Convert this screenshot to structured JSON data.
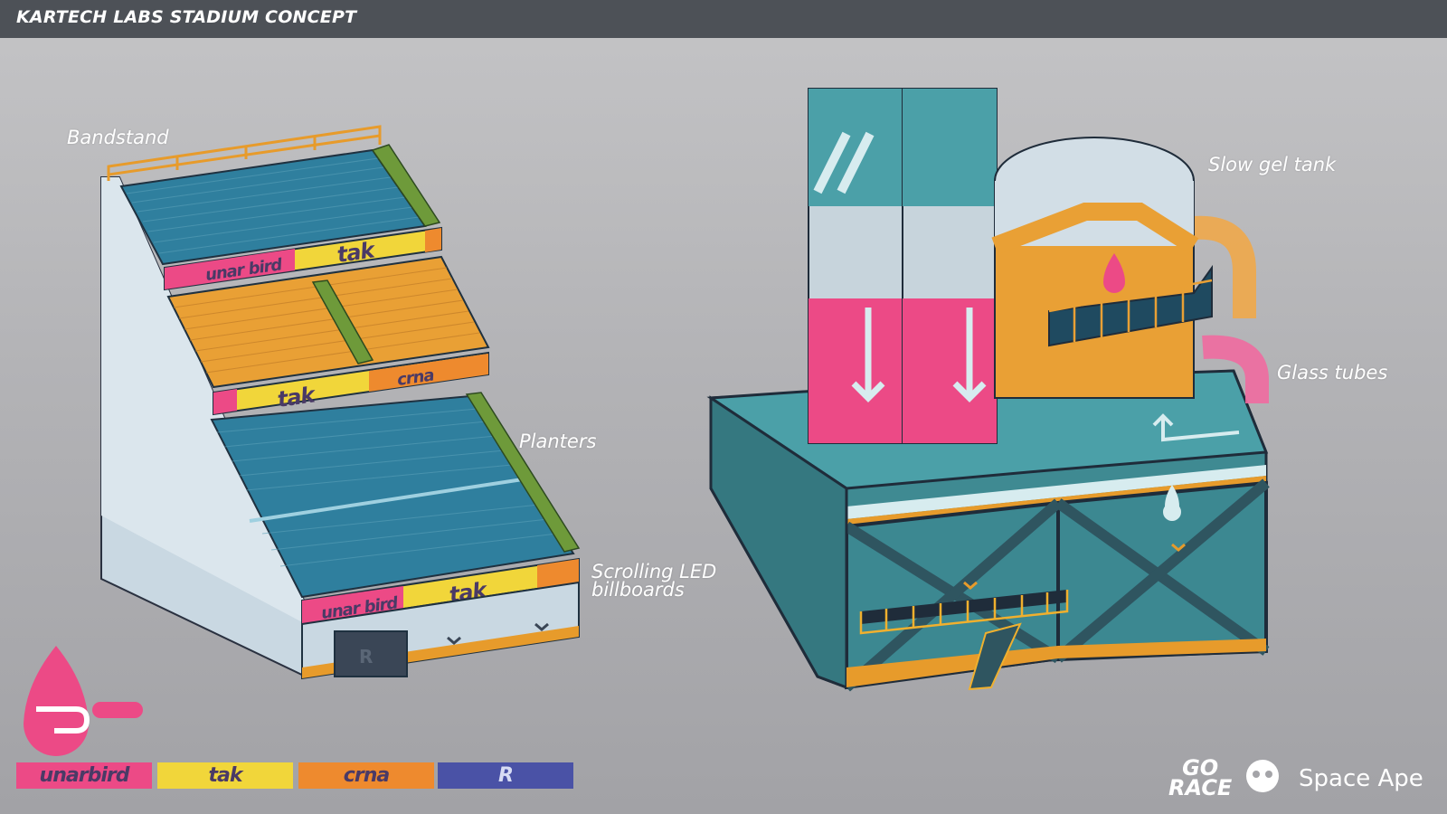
{
  "header": {
    "title": "KARTECH LABS STADIUM CONCEPT"
  },
  "callouts": {
    "bandstand": "Bandstand",
    "planters": "Planters",
    "billboards": "Scrolling LED\nbillboards",
    "gel_tank": "Slow gel tank",
    "glass_tubes": "Glass tubes"
  },
  "sponsors": [
    "unarbird",
    "tak",
    "crna",
    "R"
  ],
  "palette": {
    "pink": "#ec4a86",
    "yellow": "#f1d63a",
    "orange": "#ee8a2e",
    "blue": "#4a52a6",
    "teal": "#4ba0a8",
    "pole_grey": "#c7d4dc"
  },
  "branding": {
    "game": "GO\nRACE",
    "studio": "Space Ape"
  }
}
